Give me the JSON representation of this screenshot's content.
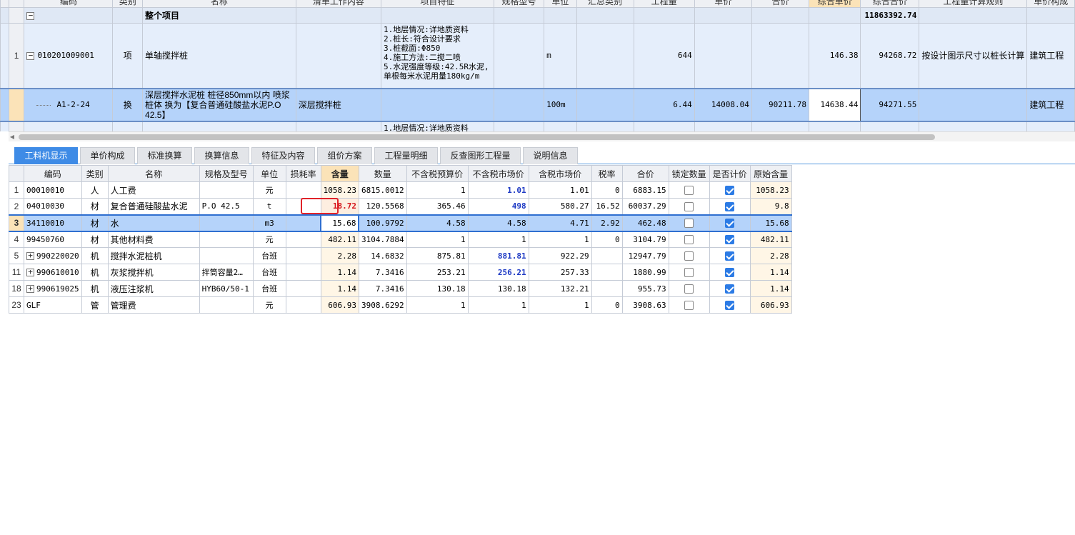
{
  "upper_grid": {
    "headers": [
      "编码",
      "类别",
      "名称",
      "清单工作内容",
      "项目特征",
      "规格型号",
      "单位",
      "汇总类别",
      "工程量",
      "单价",
      "合价",
      "综合单价",
      "综合合价",
      "工程量计算规则",
      "单价构成"
    ],
    "total_row": {
      "toggle": "−",
      "name": "整个项目",
      "total": "11863392.74"
    },
    "rows": [
      {
        "num": "1",
        "toggle": "−",
        "code": "010201009001",
        "type": "项",
        "name": "单轴搅拌桩",
        "features": [
          "1.地层情况:详地质资料",
          "2.桩长:符合设计要求",
          "3.桩截面:Φ850",
          "4.施工方法:二搅二喷",
          "5.水泥强度等级:42.5R水泥,",
          "单根每米水泥用量180kg/m"
        ],
        "unit": "m",
        "quantity": "644",
        "unit_total": "146.38",
        "grand_total": "94268.72",
        "calc_rule": "按设计图示尺寸以桩长计算",
        "price_comp": "建筑工程"
      },
      {
        "num": "",
        "code": "A1-2-24",
        "type": "换",
        "name": "深层搅拌水泥桩 桩径850mm以内 喷浆桩体  换为【复合普通硅酸盐水泥P.O 42.5】",
        "work_content": "深层搅拌桩",
        "unit": "100m",
        "quantity": "6.44",
        "unit_price": "14008.04",
        "total_price": "90211.78",
        "unit_total": "14638.44",
        "grand_total": "94271.55",
        "price_comp": "建筑工程"
      },
      {
        "features": [
          "1.地层情况:详地质资料"
        ]
      }
    ]
  },
  "tabs": [
    "工料机显示",
    "单价构成",
    "标准换算",
    "换算信息",
    "特征及内容",
    "组价方案",
    "工程量明细",
    "反查图形工程量",
    "说明信息"
  ],
  "lower_grid": {
    "headers": [
      "编码",
      "类别",
      "名称",
      "规格及型号",
      "单位",
      "损耗率",
      "含量",
      "数量",
      "不含税预算价",
      "不含税市场价",
      "含税市场价",
      "税率",
      "合价",
      "锁定数量",
      "是否计价",
      "原始含量"
    ],
    "rows": [
      {
        "num": "1",
        "code": "00010010",
        "type": "人",
        "name": "人工费",
        "spec": "",
        "unit": "元",
        "loss": "",
        "content": "1058.23",
        "qty": "6815.0012",
        "budget": "1",
        "market": "1.01",
        "tax_market": "1.01",
        "tax_rate": "0",
        "total": "6883.15",
        "locked": false,
        "priced": true,
        "orig": "1058.23"
      },
      {
        "num": "2",
        "code": "04010030",
        "type": "材",
        "name": "复合普通硅酸盐水泥",
        "spec": "P.O 42.5",
        "unit": "t",
        "loss": "",
        "content": "18.72",
        "qty": "120.5568",
        "budget": "365.46",
        "market": "498",
        "tax_market": "580.27",
        "tax_rate": "16.52",
        "total": "60037.29",
        "locked": false,
        "priced": true,
        "orig": "9.8"
      },
      {
        "num": "3",
        "code": "34110010",
        "type": "材",
        "name": "水",
        "spec": "",
        "unit": "m3",
        "loss": "",
        "content": "15.68",
        "qty": "100.9792",
        "budget": "4.58",
        "market": "4.58",
        "tax_market": "4.71",
        "tax_rate": "2.92",
        "total": "462.48",
        "locked": false,
        "priced": true,
        "orig": "15.68"
      },
      {
        "num": "4",
        "code": "99450760",
        "type": "材",
        "name": "其他材料费",
        "spec": "",
        "unit": "元",
        "loss": "",
        "content": "482.11",
        "qty": "3104.7884",
        "budget": "1",
        "market": "1",
        "tax_market": "1",
        "tax_rate": "0",
        "total": "3104.79",
        "locked": false,
        "priced": true,
        "orig": "482.11"
      },
      {
        "num": "5",
        "toggle": "+",
        "code": "990220020",
        "type": "机",
        "name": "搅拌水泥桩机",
        "spec": "",
        "unit": "台班",
        "loss": "",
        "content": "2.28",
        "qty": "14.6832",
        "budget": "875.81",
        "market": "881.81",
        "tax_market": "922.29",
        "tax_rate": "",
        "total": "12947.79",
        "locked": false,
        "priced": true,
        "orig": "2.28"
      },
      {
        "num": "11",
        "toggle": "+",
        "code": "990610010",
        "type": "机",
        "name": "灰浆搅拌机",
        "spec": "拌筒容量2…",
        "unit": "台班",
        "loss": "",
        "content": "1.14",
        "qty": "7.3416",
        "budget": "253.21",
        "market": "256.21",
        "tax_market": "257.33",
        "tax_rate": "",
        "total": "1880.99",
        "locked": false,
        "priced": true,
        "orig": "1.14"
      },
      {
        "num": "18",
        "toggle": "+",
        "code": "990619025",
        "type": "机",
        "name": "液压注浆机",
        "spec": "HYB60/50-1",
        "unit": "台班",
        "loss": "",
        "content": "1.14",
        "qty": "7.3416",
        "budget": "130.18",
        "market": "130.18",
        "tax_market": "132.21",
        "tax_rate": "",
        "total": "955.73",
        "locked": false,
        "priced": true,
        "orig": "1.14"
      },
      {
        "num": "23",
        "code": "GLF",
        "type": "管",
        "name": "管理费",
        "spec": "",
        "unit": "元",
        "loss": "",
        "content": "606.93",
        "qty": "3908.6292",
        "budget": "1",
        "market": "1",
        "tax_market": "1",
        "tax_rate": "0",
        "total": "3908.63",
        "locked": false,
        "priced": true,
        "orig": "606.93"
      }
    ]
  },
  "colors": {
    "active_tab": "#3e8be6",
    "selected_row": "#b5d3fa",
    "highlight_value": "#d4141a",
    "market_price_blue": "#1d39c4"
  }
}
